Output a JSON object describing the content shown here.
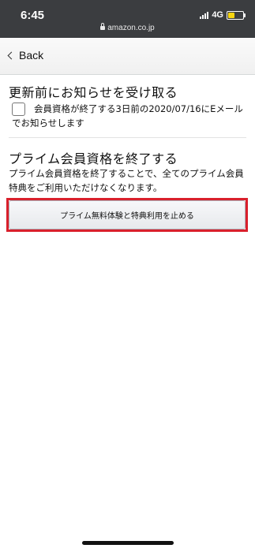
{
  "status_bar": {
    "time": "6:45",
    "network": "4G",
    "battery_state": "charging-low",
    "url": "amazon.co.jp"
  },
  "nav": {
    "back_label": "Back"
  },
  "notify_section": {
    "title": "更新前にお知らせを受け取る",
    "checkbox_label": "会員資格が終了する3日前の2020/07/16にEメールでお知らせします",
    "checked": false
  },
  "end_section": {
    "title": "プライム会員資格を終了する",
    "description": "プライム会員資格を終了することで、全てのプライム会員特典をご利用いただけなくなります。",
    "button_label": "プライム無料体験と特典利用を止める"
  },
  "colors": {
    "status_bar_bg": "#3b3d40",
    "highlight": "#d9202c",
    "battery": "#f5d40f"
  },
  "icons": [
    "signal-icon",
    "battery-icon",
    "lock-icon",
    "chevron-left-icon"
  ]
}
